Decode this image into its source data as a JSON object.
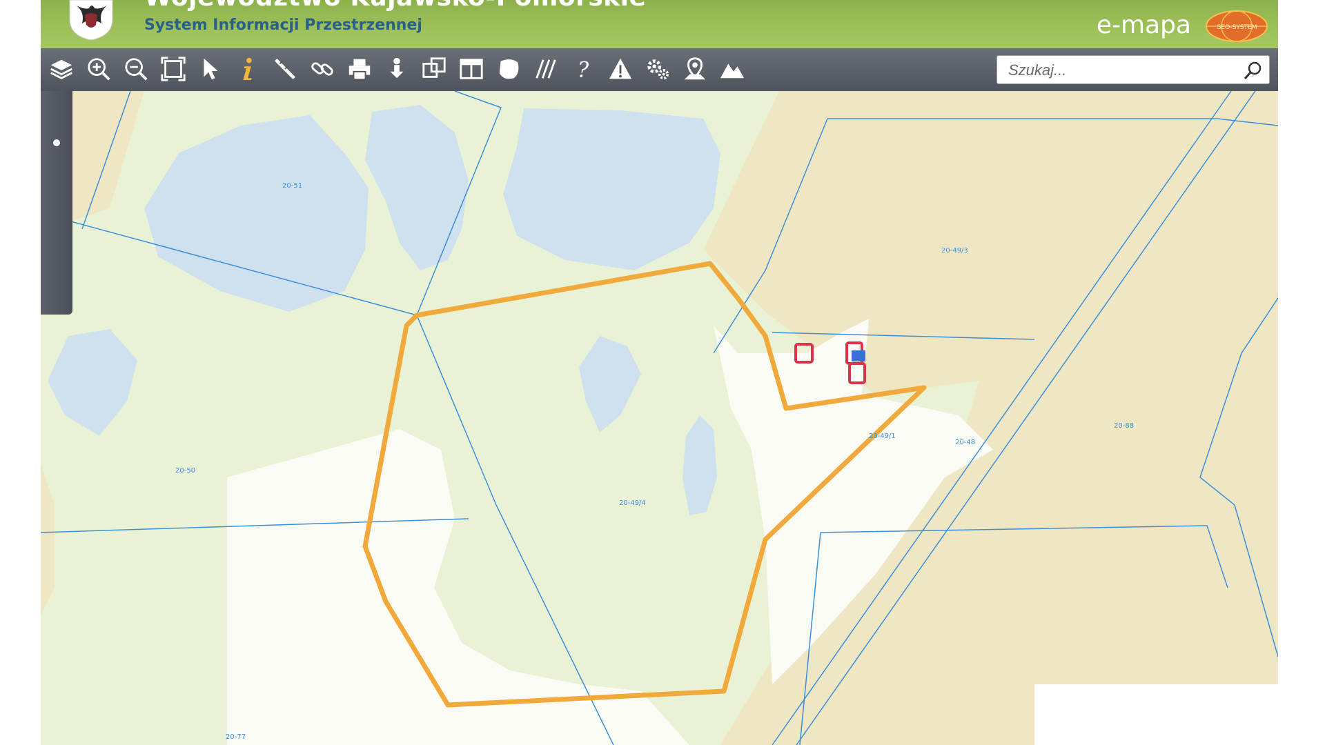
{
  "header": {
    "region_title": "Województwo Kujawsko-Pomorskie",
    "system_subtitle": "System Informacji Przestrzennej",
    "brand": "e-mapa",
    "brand_badge": "GEO-SYSTEM"
  },
  "toolbar": {
    "tools": [
      {
        "name": "layers-icon",
        "label": "Warstwy"
      },
      {
        "name": "zoom-in-icon",
        "label": "Powiększ"
      },
      {
        "name": "zoom-out-icon",
        "label": "Pomniejsz"
      },
      {
        "name": "full-extent-icon",
        "label": "Cały zasięg"
      },
      {
        "name": "select-pointer-icon",
        "label": "Wskaż"
      },
      {
        "name": "info-icon",
        "label": "Informacja"
      },
      {
        "name": "measure-ruler-icon",
        "label": "Pomiar"
      },
      {
        "name": "link-icon",
        "label": "Link"
      },
      {
        "name": "print-icon",
        "label": "Drukuj"
      },
      {
        "name": "download-icon",
        "label": "Pobierz"
      },
      {
        "name": "overlay-icon",
        "label": "Nakładka"
      },
      {
        "name": "layout-icon",
        "label": "Układ"
      },
      {
        "name": "shape-icon",
        "label": "Obiekt"
      },
      {
        "name": "hatch-icon",
        "label": "Kreskowanie"
      },
      {
        "name": "help-icon",
        "label": "Pomoc"
      },
      {
        "name": "warning-icon",
        "label": "Ostrzeżenie"
      },
      {
        "name": "settings-icon",
        "label": "Ustawienia"
      },
      {
        "name": "locate-icon",
        "label": "Lokalizuj"
      },
      {
        "name": "terrain-icon",
        "label": "Teren"
      }
    ]
  },
  "search": {
    "placeholder": "Szukaj..."
  },
  "map": {
    "parcel_labels": {
      "p1": "20-51",
      "p2": "20-49/3",
      "p3": "20-50",
      "p4": "20-49/4",
      "p5": "20-49/1",
      "p6": "20-48",
      "p7": "20-88",
      "p8": "20-77"
    },
    "colors": {
      "forest_green": "#eaf2d6",
      "agricultural_tan": "#efe6c4",
      "water_blue": "#cfe0ee",
      "open_white": "#fbfbf6",
      "parcel_lines": "#3c8fd9",
      "selection_outline": "#f0a93a",
      "buildings": "#d9344a"
    }
  }
}
